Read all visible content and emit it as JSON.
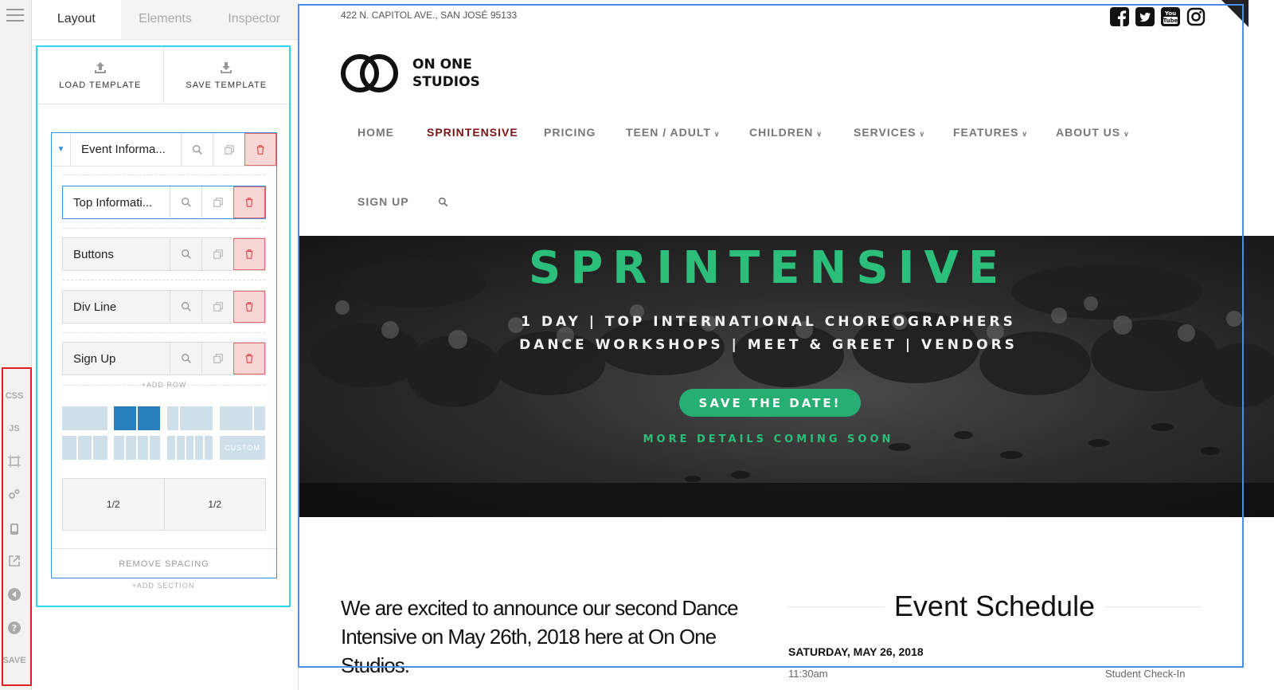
{
  "editor": {
    "tabs": [
      "Layout",
      "Elements",
      "Inspector"
    ],
    "load_template": "LOAD TEMPLATE",
    "save_template": "SAVE TEMPLATE",
    "section_name": "Event Informa...",
    "rows": [
      "Top Informati...",
      "Buttons",
      "Div Line",
      "Sign Up"
    ],
    "add_row": "+ADD ROW",
    "custom_label": "CUSTOM",
    "columns": [
      "1/2",
      "1/2"
    ],
    "remove_spacing": "REMOVE SPACING",
    "add_section": "+ADD SECTION"
  },
  "rail": {
    "css": "CSS",
    "js": "JS",
    "save": "SAVE",
    "icons": [
      "menu-icon",
      "frame-icon",
      "settings-icon",
      "mobile-icon",
      "external-link-icon",
      "back-icon",
      "help-icon"
    ]
  },
  "site": {
    "address": "422 N. CAPITOL AVE., SAN JOSÉ 95133",
    "logo_line1": "ON ONE",
    "logo_line2": "STUDIOS",
    "social": [
      "facebook-icon",
      "twitter-icon",
      "youtube-icon",
      "instagram-icon"
    ],
    "youtube_text": "You Tube",
    "nav": [
      "HOME",
      "SPRINTENSIVE",
      "PRICING",
      "TEEN / ADULT",
      "CHILDREN",
      "SERVICES",
      "FEATURES",
      "ABOUT US",
      "SIGN UP"
    ],
    "nav_active": "SPRINTENSIVE",
    "hero": {
      "title": "SPRINTENSIVE",
      "line1": "1 DAY  |  TOP INTERNATIONAL CHOREOGRAPHERS",
      "line2": "DANCE WORKSHOPS | MEET & GREET | VENDORS",
      "button": "SAVE THE DATE!",
      "more": "MORE DETAILS COMING SOON"
    },
    "announcement": "We are excited to announce our second Dance Intensive on May 26th, 2018 here at On One Studios.",
    "schedule_title": "Event Schedule",
    "schedule_date": "SATURDAY, MAY 26, 2018",
    "schedule_time": "11:30am",
    "schedule_item": "Student Check-In"
  },
  "colors": {
    "accent_green": "#2bbf7b",
    "active_nav": "#7a1414",
    "selection_blue": "#4a8fe7",
    "panel_cyan": "#2fd6ec",
    "rail_red": "#e02020",
    "delete_red": "#e06a6a"
  }
}
